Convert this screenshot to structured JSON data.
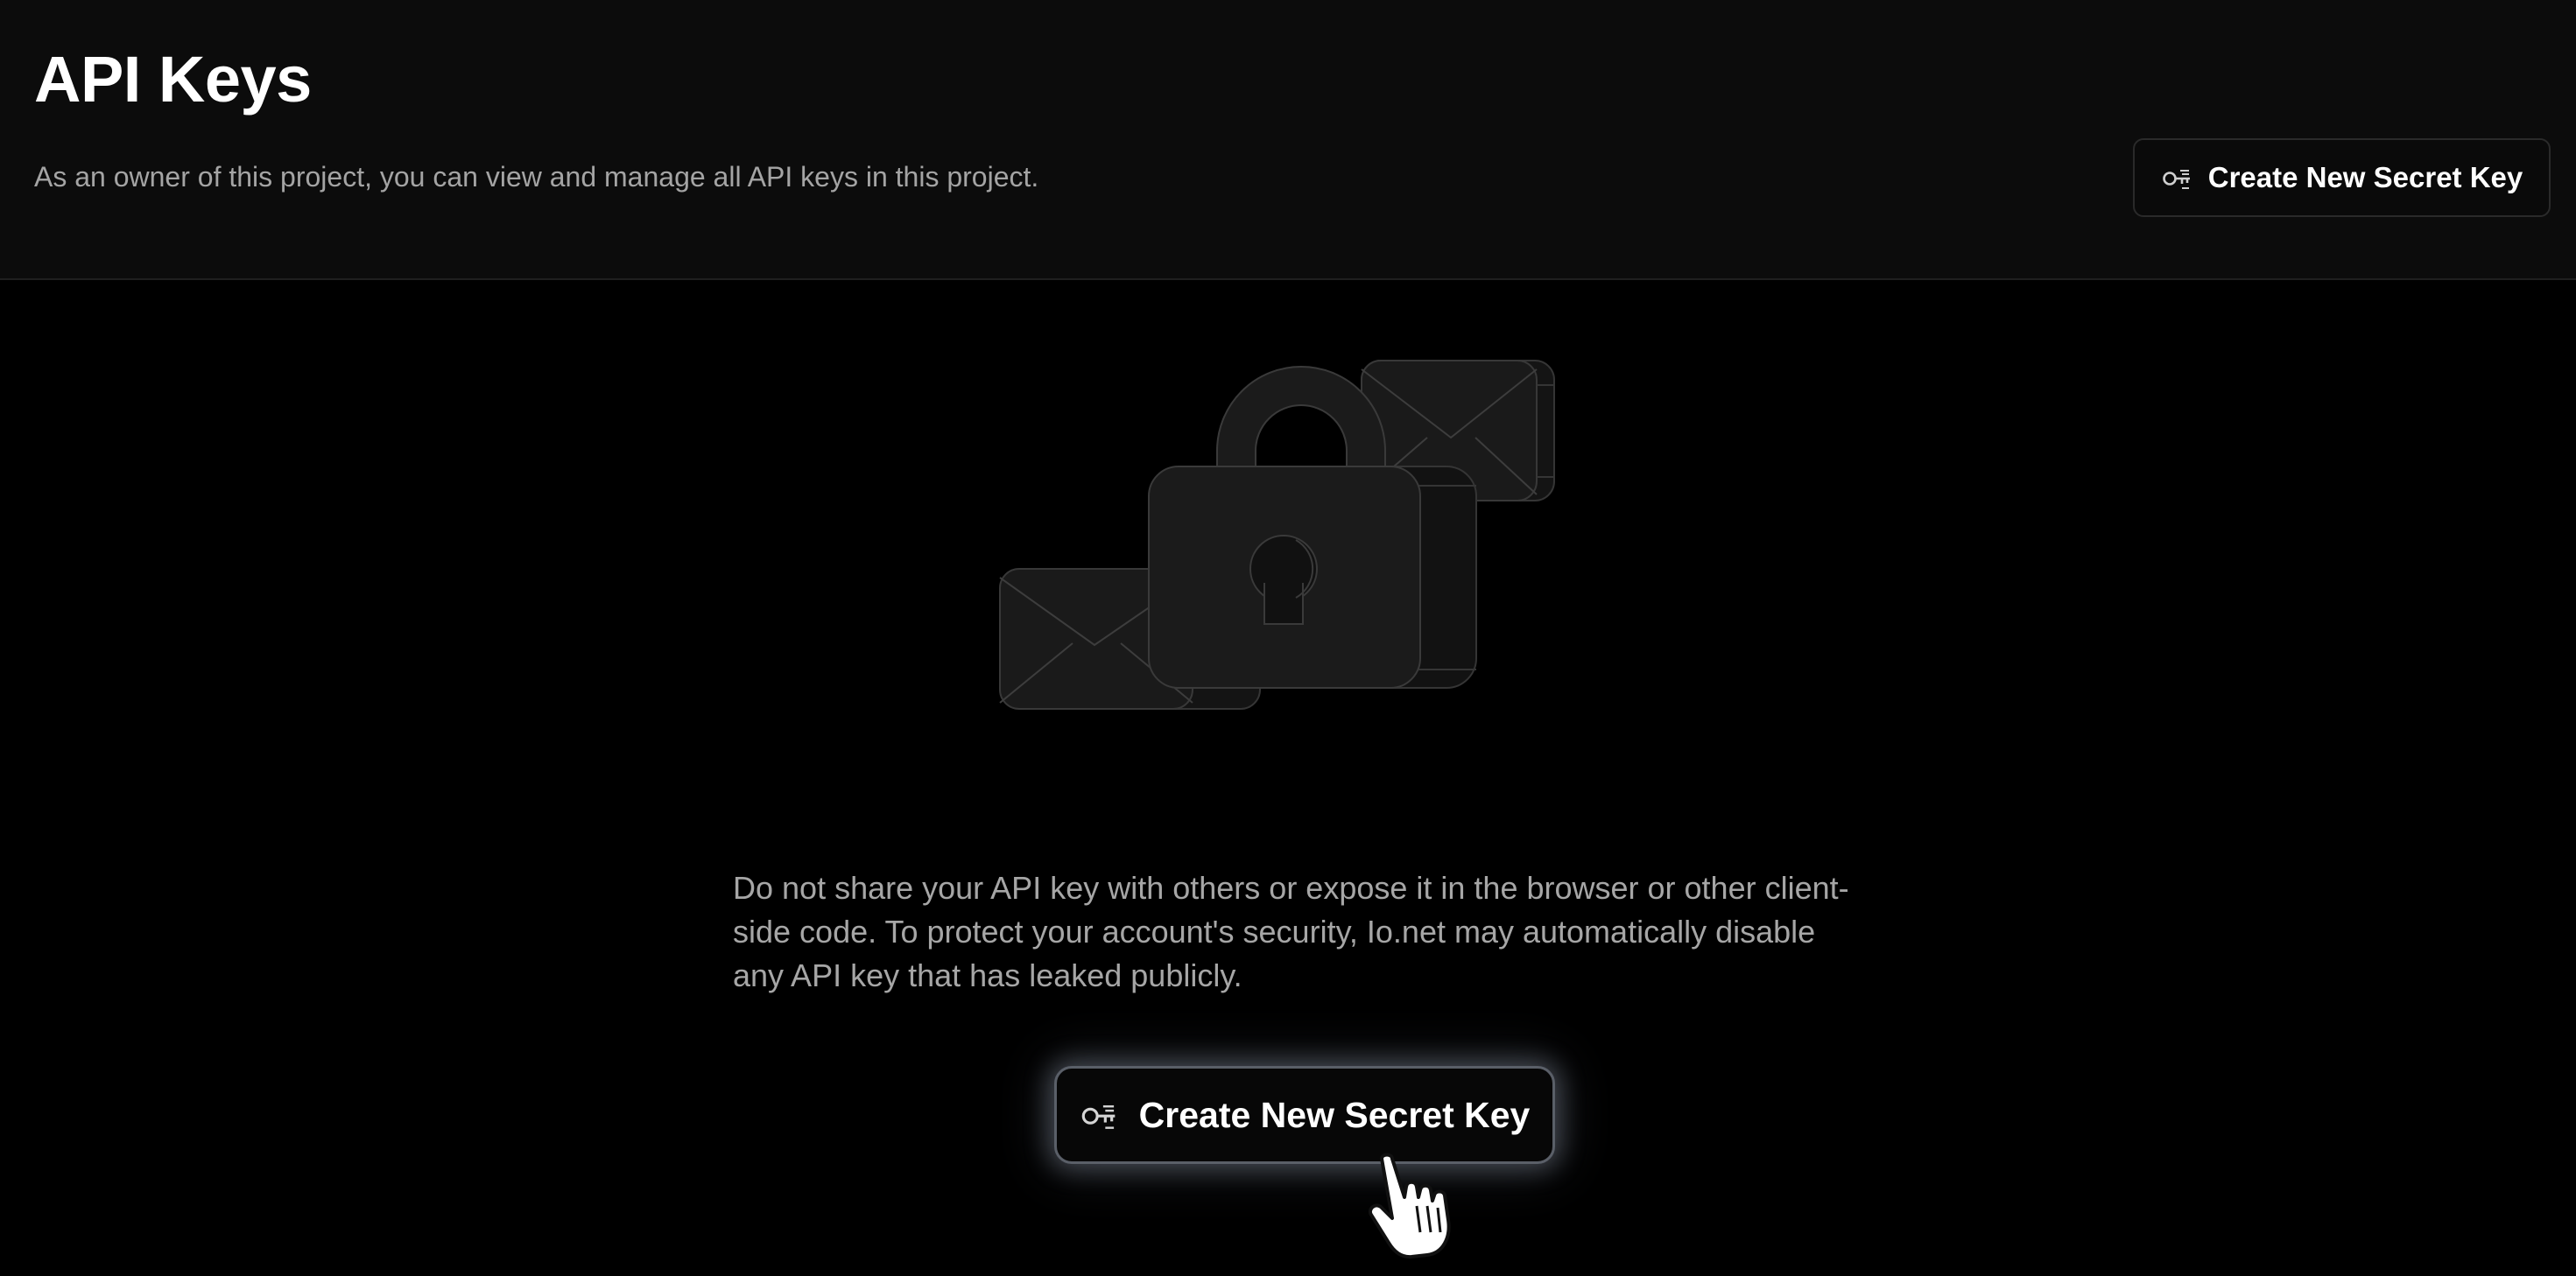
{
  "header": {
    "title": "API Keys",
    "subtitle": "As an owner of this project, you can view and manage all API keys in this project.",
    "create_button_label": "Create New Secret Key"
  },
  "main": {
    "warning": "Do not share your API key with others or expose it in the browser or other client-side code. To protect your account's security, Io.net may automatically disable any API key that has leaked publicly.",
    "create_button_label": "Create New Secret Key"
  },
  "icons": {
    "button_icon": "key-icon",
    "illustration": "lock-envelopes-illustration",
    "cursor": "hand-pointer-cursor"
  },
  "colors": {
    "page_background": "#000000",
    "header_background": "#0c0c0c",
    "primary_text": "#ffffff",
    "secondary_text": "#a4a4a4",
    "cta_glow": "#aab4c8"
  }
}
